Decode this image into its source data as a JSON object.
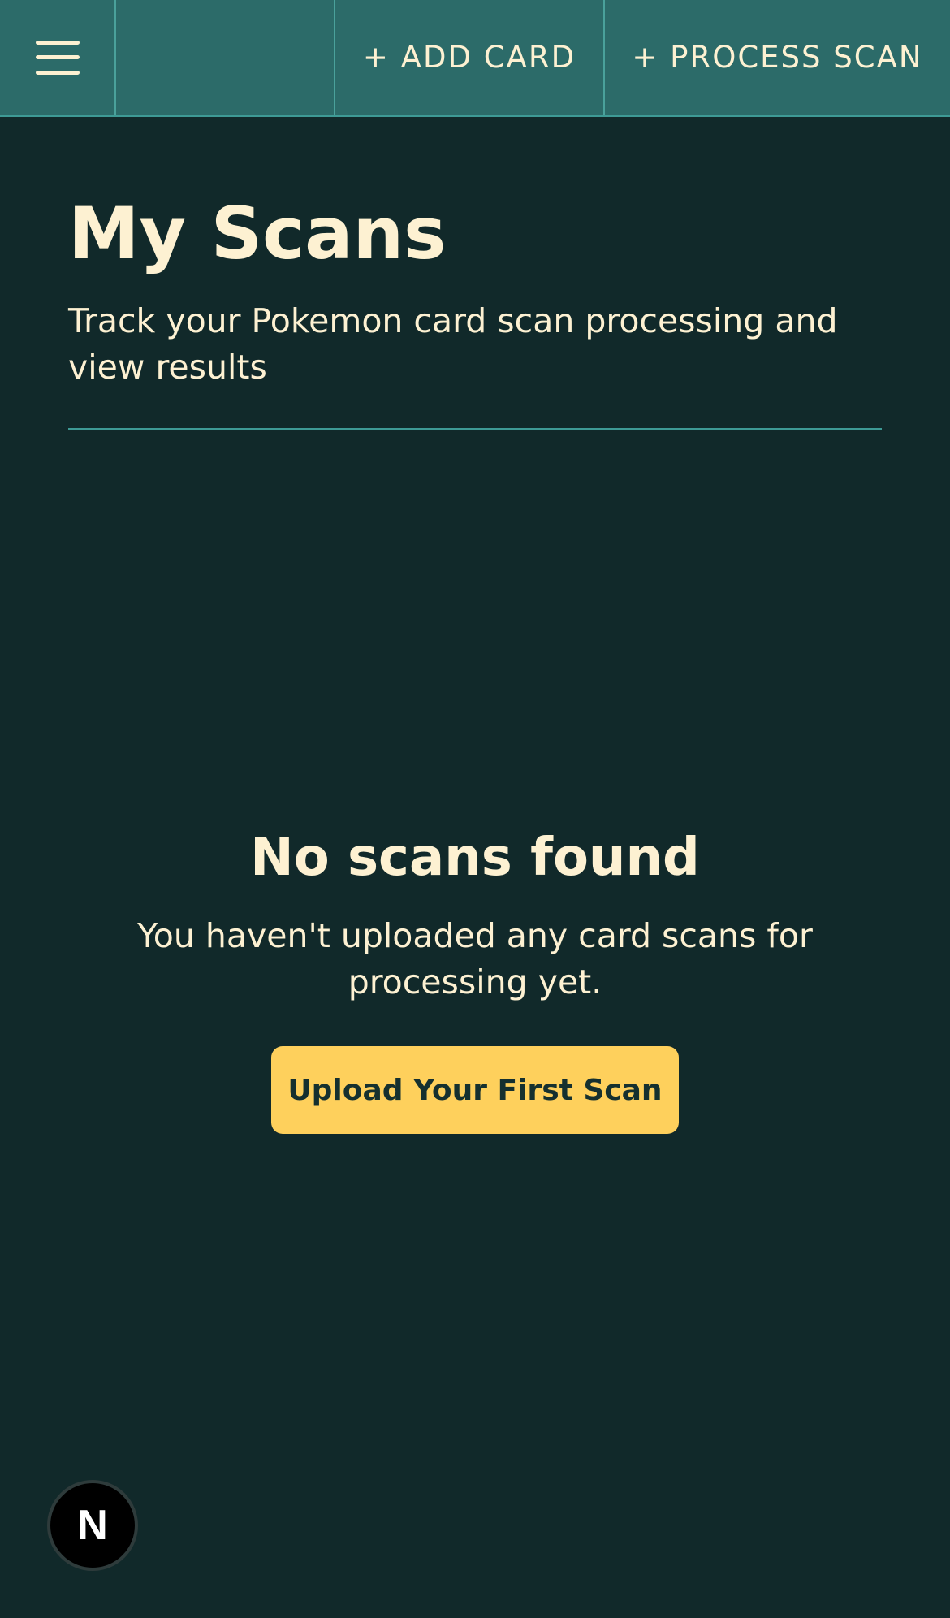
{
  "nav": {
    "add_card_label": "+ ADD CARD",
    "process_scan_label": "+ PROCESS SCAN"
  },
  "header": {
    "title": "My Scans",
    "subtitle": "Track your Pokemon card scan processing and view results"
  },
  "empty_state": {
    "title": "No scans found",
    "message": "You haven't uploaded any card scans for processing yet.",
    "button_label": "Upload Your First Scan"
  },
  "dev_badge": {
    "letter": "N"
  },
  "icons": {
    "menu": "hamburger-menu-icon"
  },
  "colors": {
    "background": "#11292a",
    "topbar": "#2c6b69",
    "text": "#fdf1d2",
    "accent_button": "#fed05c",
    "divider": "#3e9a95"
  }
}
